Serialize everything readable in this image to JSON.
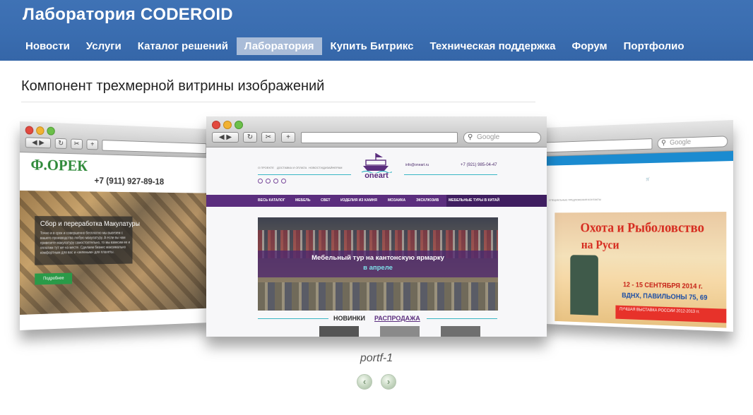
{
  "header": {
    "title": "Лаборатория CODEROID",
    "nav": [
      {
        "label": "Новости"
      },
      {
        "label": "Услуги"
      },
      {
        "label": "Каталог решений"
      },
      {
        "label": "Лаборатория",
        "active": true
      },
      {
        "label": "Купить Битрикс"
      },
      {
        "label": "Техническая поддержка"
      },
      {
        "label": "Форум"
      },
      {
        "label": "Портфолио"
      }
    ]
  },
  "page": {
    "heading": "Компонент трехмерной витрины изображений"
  },
  "carousel": {
    "caption": "portf-1",
    "prev_icon": "chevron-left-icon",
    "next_icon": "chevron-right-icon",
    "browser": {
      "search_placeholder": "Google"
    },
    "slides": {
      "center": {
        "logo": "oneart",
        "phone": "+7 (921) 985-04-47",
        "email": "info@oneart.ru",
        "top_links": [
          "О ПРОЕКТЕ",
          "ДОСТАВКА И ОПЛАТА",
          "НОВОСТИ",
          "ДИЗАЙНЕРАМ"
        ],
        "menu": [
          "ВЕСЬ КАТАЛОГ",
          "МЕБЕЛЬ",
          "СВЕТ",
          "ИЗДЕЛИЯ ИЗ КАМНЯ",
          "МОЗАИКА",
          "ЭКСКЛЮЗИВ",
          "МЕБЕЛЬНЫЕ ТУРЫ В КИТАЙ"
        ],
        "banner_line1": "Мебельный тур на кантонскую ярмарку",
        "banner_line2": "в апреле",
        "tabs": [
          "НОВИНКИ",
          "РАСПРОДАЖА"
        ]
      },
      "left": {
        "logo": "Ф.ОРЕК",
        "phone": "+7 (911) 927-89-18",
        "panel_title": "Сбор и переработка Макулатуры",
        "panel_text": "Точно и в срок и совершенно бесплатно мы вывезем с вашего производства любую макулатуру. А если вы нам привезете макулатуру самостоятельно, то мы взвесим ее и оплатим тут же на месте. Сделаем бизнес максимально комфортным для вас и «зеленым» для планеты.",
        "button": "Подробнее"
      },
      "right": {
        "title_line1": "Охота и Рыболовство",
        "title_line2": "на Руси",
        "date": "12 - 15 СЕНТЯБРЯ 2014 г.",
        "place": "ВДНХ, ПАВИЛЬОНЫ 75, 69",
        "bottom_text": "ЛУЧШАЯ ВЫСТАВКА РОССИИ 2012-2013 гг.",
        "menu_text": "СПЕЦИАЛЬНЫЕ ПРЕДЛОЖЕНИЯ   КОНТАКТЫ"
      }
    }
  }
}
